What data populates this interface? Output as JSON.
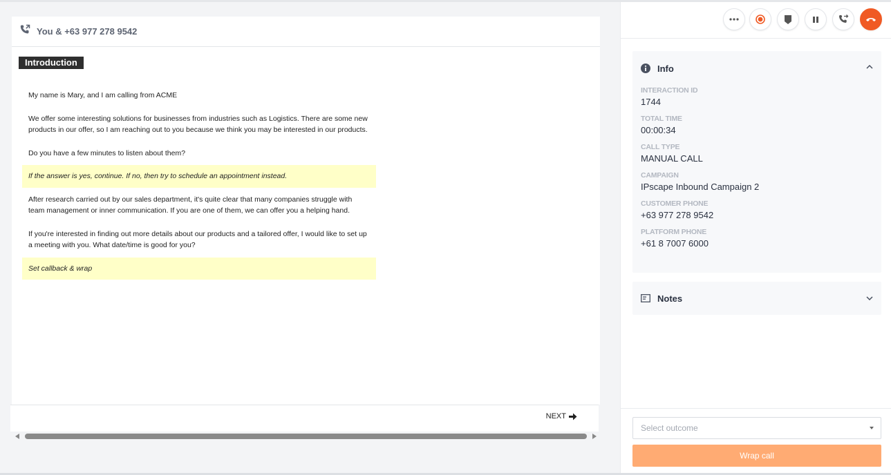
{
  "script": {
    "header_title": "You & +63 977 278 9542",
    "section_title": "Introduction",
    "paragraphs": [
      "My name is Mary, and I am calling from ACME",
      "We offer some interesting solutions for businesses from industries such as Logistics. There are some new products in our offer, so I am reaching out to you because we think you may be interested in our products.",
      "Do you have a few minutes to listen about them?"
    ],
    "note1": "If the answer is yes, continue. If no, then try to schedule an appointment instead.",
    "paragraphs2": [
      "After research carried out by our sales department, it's quite clear that many companies struggle with team management or inner communication. If you are one of them, we can offer you a helping hand.",
      "If you're interested in finding out more details about our products and a tailored offer, I would like to set up a meeting with you. What date/time is good for you?"
    ],
    "note2": "Set callback & wrap",
    "next_label": "NEXT"
  },
  "toolbar": {
    "buttons": [
      "more-icon",
      "record-icon",
      "tag-icon",
      "pause-icon",
      "transfer-icon",
      "hangup-icon"
    ],
    "hangup_color": "#f05a24"
  },
  "info": {
    "title": "Info",
    "fields": [
      {
        "key": "INTERACTION ID",
        "value": "1744"
      },
      {
        "key": "TOTAL TIME",
        "value": "00:00:34"
      },
      {
        "key": "CALL TYPE",
        "value": "MANUAL CALL"
      },
      {
        "key": "CAMPAIGN",
        "value": "IPscape Inbound Campaign 2"
      },
      {
        "key": "CUSTOMER PHONE",
        "value": "+63 977 278 9542"
      },
      {
        "key": "PLATFORM PHONE",
        "value": "+61 8 7007 6000"
      }
    ]
  },
  "notes": {
    "title": "Notes"
  },
  "footer": {
    "select_placeholder": "Select outcome",
    "wrap_label": "Wrap call",
    "wrap_color": "#ffab73"
  }
}
